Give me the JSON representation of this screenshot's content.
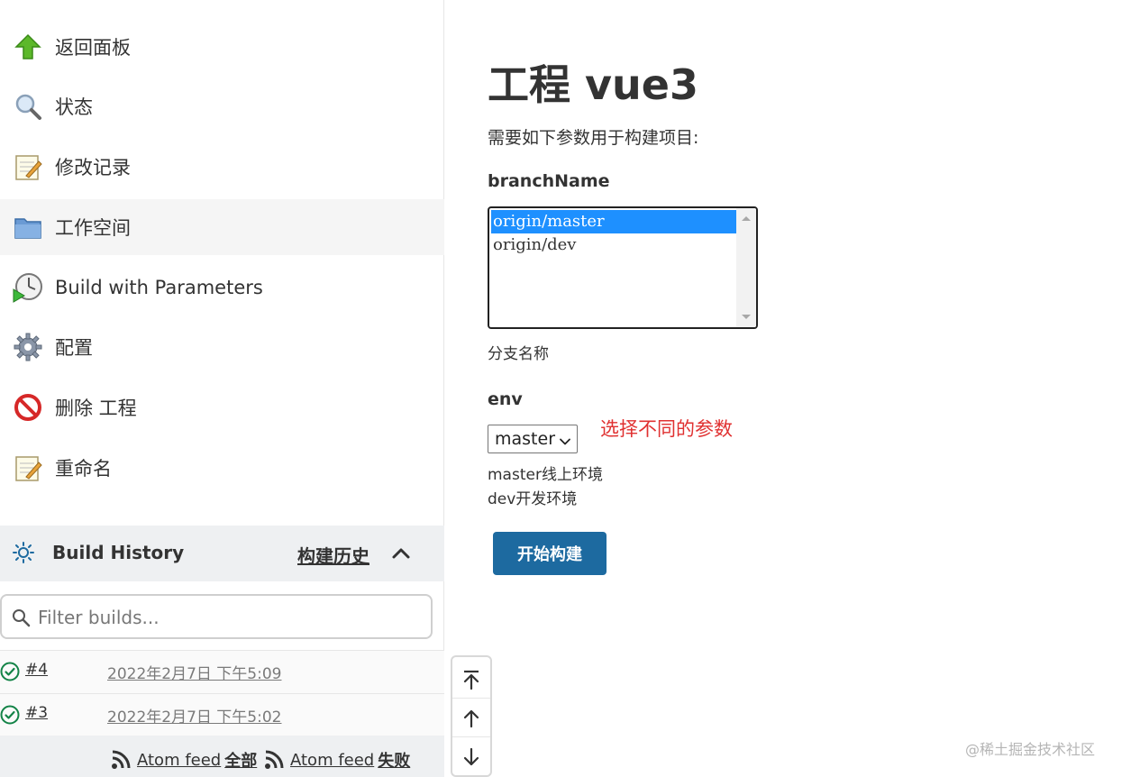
{
  "sidebar": {
    "tasks": [
      {
        "label": "返回面板",
        "icon": "up-arrow-icon"
      },
      {
        "label": "状态",
        "icon": "magnifier-icon"
      },
      {
        "label": "修改记录",
        "icon": "notepad-icon"
      },
      {
        "label": "工作空间",
        "icon": "folder-icon"
      },
      {
        "label": "Build with Parameters",
        "icon": "clock-play-icon"
      },
      {
        "label": "配置",
        "icon": "gear-icon"
      },
      {
        "label": "删除 工程",
        "icon": "no-entry-icon"
      },
      {
        "label": "重命名",
        "icon": "notepad-icon"
      }
    ]
  },
  "build_history": {
    "title": "Build History",
    "trend_link": "构建历史",
    "filter_placeholder": "Filter builds...",
    "builds": [
      {
        "number": "#4",
        "date": "2022年2月7日 下午5:09",
        "status": "success"
      },
      {
        "number": "#3",
        "date": "2022年2月7日 下午5:02",
        "status": "success"
      }
    ],
    "feeds": [
      {
        "label": "Atom feed",
        "bold": "全部"
      },
      {
        "label": "Atom feed",
        "bold": "失败"
      }
    ]
  },
  "main": {
    "title": "工程 vue3",
    "description": "需要如下参数用于构建项目:",
    "params": {
      "branch": {
        "name": "branchName",
        "options": [
          "origin/master",
          "origin/dev"
        ],
        "selected": "origin/master",
        "description": "分支名称"
      },
      "env": {
        "name": "env",
        "selected": "master",
        "description_lines": [
          "master线上环境",
          "dev开发环境"
        ]
      }
    },
    "annotation": "选择不同的参数",
    "build_button": "开始构建"
  },
  "watermark": "@稀土掘金技术社区",
  "colors": {
    "accent": "#1d6aa0",
    "selection": "#1e90ff",
    "annotation": "#e03131",
    "success": "#138347"
  }
}
